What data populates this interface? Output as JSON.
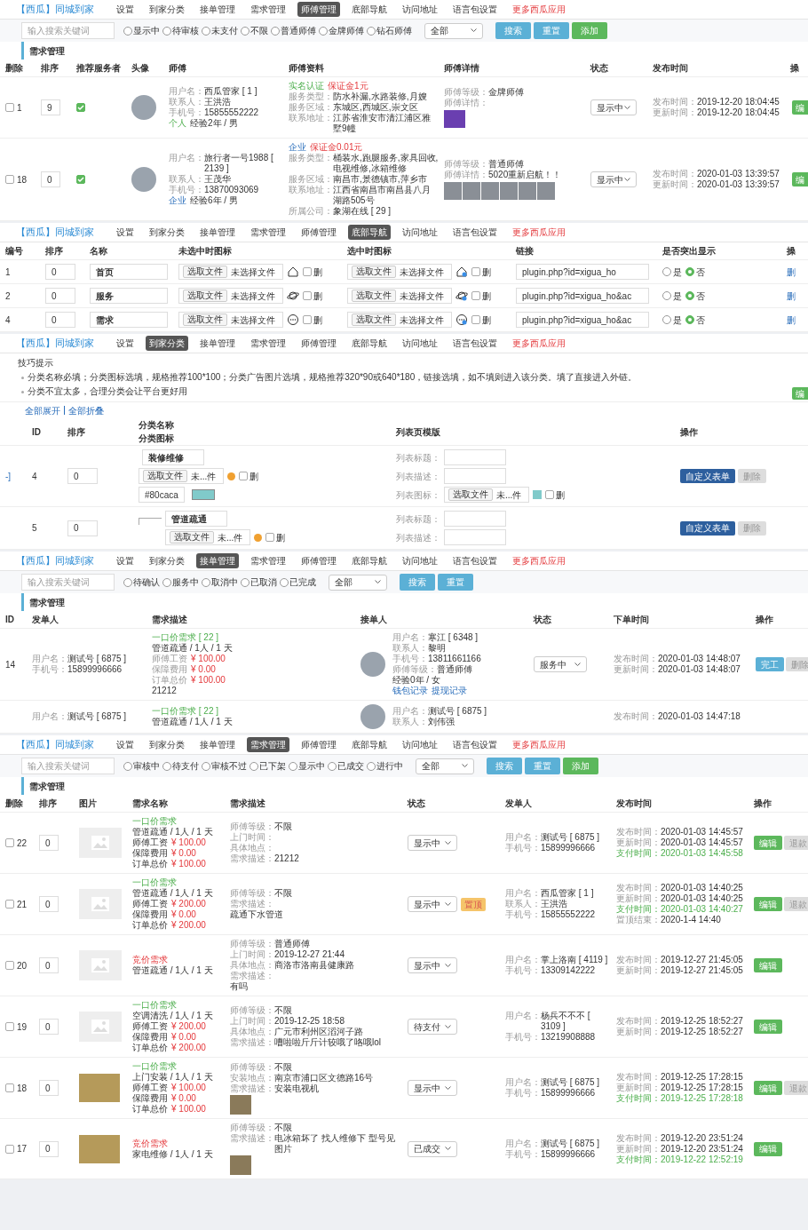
{
  "sections": [
    {
      "kind": "masters",
      "nav": {
        "brand": "【西瓜】同城到家",
        "items": [
          {
            "label": "设置",
            "selected": false
          },
          {
            "label": "到家分类",
            "selected": false
          },
          {
            "label": "接单管理",
            "selected": false
          },
          {
            "label": "需求管理",
            "selected": false
          },
          {
            "label": "师傅管理",
            "selected": true
          },
          {
            "label": "底部导航",
            "selected": false
          },
          {
            "label": "访问地址",
            "selected": false
          },
          {
            "label": "语言包设置",
            "selected": false
          },
          {
            "label": "更多西瓜应用",
            "selected": false,
            "kind": "promo"
          }
        ]
      },
      "toolbar": {
        "placeholder": "输入搜索关键词",
        "radios": [
          {
            "label": "显示中",
            "selected": false
          },
          {
            "label": "待审核",
            "selected": false
          },
          {
            "label": "未支付",
            "selected": false
          },
          {
            "label": "不限",
            "selected": false
          },
          {
            "label": "普通师傅",
            "selected": false
          },
          {
            "label": "金牌师傅",
            "selected": false
          },
          {
            "label": "钻石师傅",
            "selected": false
          }
        ],
        "select": "全部",
        "buttons": [
          {
            "label": "搜索",
            "kind": "search"
          },
          {
            "label": "重置",
            "kind": "reset"
          },
          {
            "label": "添加",
            "kind": "add"
          }
        ]
      },
      "title": "需求管理",
      "columns": [
        "删除",
        "排序",
        "推荐服务者",
        "头像",
        "师傅",
        "师傅资料",
        "师傅详情",
        "状态",
        "发布时间",
        "操"
      ],
      "rows": [
        {
          "id": "1",
          "checked": false,
          "sort": "9",
          "recommended": true,
          "master": [
            {
              "kind": "field",
              "label": "用户名：",
              "value": "西瓜管家 [ 1 ]"
            },
            {
              "kind": "field",
              "label": "联系人：",
              "value": "王洪浩"
            },
            {
              "kind": "field",
              "label": "手机号：",
              "value": "15855552222"
            },
            {
              "kind": "personal",
              "label": "个人",
              "value": "经验2年 / 男"
            }
          ],
          "profile": [
            {
              "kind": "verified",
              "label": "实名认证",
              "value": "保证金1元"
            },
            {
              "kind": "field",
              "label": "服务类型：",
              "value": "防水补漏,水路装修,月嫂"
            },
            {
              "kind": "field",
              "label": "服务区域：",
              "value": "东城区,西城区,崇文区"
            },
            {
              "kind": "field",
              "label": "联系地址：",
              "value": "江苏省淮安市清江浦区雅墅9幢"
            }
          ],
          "detail": [
            {
              "kind": "field",
              "label": "师傅等级：",
              "value": "金牌师傅"
            },
            {
              "kind": "field",
              "label": "师傅详情："
            }
          ],
          "photo_strip": false,
          "status": "显示中",
          "times": [
            {
              "kind": "field",
              "label": "发布时间：",
              "value": "2019-12-20 18:04:45"
            },
            {
              "kind": "field",
              "label": "更新时间：",
              "value": "2019-12-20 18:04:45"
            }
          ],
          "action": "编"
        },
        {
          "id": "18",
          "checked": false,
          "sort": "0",
          "recommended": true,
          "master": [
            {
              "kind": "field",
              "label": "用户名：",
              "value": "旅行者一号1988 [ 2139 ]"
            },
            {
              "kind": "field",
              "label": "联系人：",
              "value": "王茂华"
            },
            {
              "kind": "field",
              "label": "手机号：",
              "value": "13870093069"
            },
            {
              "kind": "company",
              "label": "企业",
              "value": "经验6年 / 男"
            }
          ],
          "profile": [
            {
              "kind": "company_deposit",
              "label": "企业",
              "value": "保证金0.01元"
            },
            {
              "kind": "field",
              "label": "服务类型：",
              "value": "桶装水,跑腿服务,家具回收,电视维修,冰箱维修"
            },
            {
              "kind": "field",
              "label": "服务区域：",
              "value": "南昌市,景德镇市,萍乡市"
            },
            {
              "kind": "field",
              "label": "联系地址：",
              "value": "江西省南昌市南昌县八月湖路505号"
            },
            {
              "kind": "field",
              "label": "所属公司：",
              "value": "象湖在线 [ 29 ]"
            }
          ],
          "detail": [
            {
              "kind": "field",
              "label": "师傅等级：",
              "value": "普通师傅"
            },
            {
              "kind": "field",
              "label": "师傅详情：",
              "value": "5020重新启航！！"
            }
          ],
          "photo_strip": true,
          "status": "显示中",
          "times": [
            {
              "kind": "field",
              "label": "发布时间：",
              "value": "2020-01-03 13:39:57"
            },
            {
              "kind": "field",
              "label": "更新时间：",
              "value": "2020-01-03 13:39:57"
            }
          ],
          "action": "编"
        }
      ]
    },
    {
      "kind": "tabbar",
      "nav": {
        "brand": "【西瓜】同城到家",
        "items": [
          {
            "label": "设置",
            "selected": false
          },
          {
            "label": "到家分类",
            "selected": false
          },
          {
            "label": "接单管理",
            "selected": false
          },
          {
            "label": "需求管理",
            "selected": false
          },
          {
            "label": "师傅管理",
            "selected": false
          },
          {
            "label": "底部导航",
            "selected": true
          },
          {
            "label": "访问地址",
            "selected": false
          },
          {
            "label": "语言包设置",
            "selected": false
          },
          {
            "label": "更多西瓜应用",
            "selected": false,
            "kind": "promo"
          }
        ]
      },
      "columns": [
        "编号",
        "排序",
        "名称",
        "未选中时图标",
        "选中时图标",
        "链接",
        "是否突出显示",
        "操"
      ],
      "rows": [
        {
          "id": "1",
          "sort": "0",
          "name": "首页",
          "file_button": "选取文件",
          "file_status": "未选择文件",
          "selected_file_button": "选取文件",
          "selected_file_status": "未选择文件",
          "delete_label": "删",
          "delete_checked": false,
          "selected_delete_label": "删",
          "selected_delete_checked": false,
          "link": "plugin.php?id=xigua_ho",
          "options": [
            {
              "label": "是",
              "selected": false
            },
            {
              "label": "否",
              "selected": true
            }
          ],
          "action": "删"
        },
        {
          "id": "2",
          "sort": "0",
          "name": "服务",
          "file_button": "选取文件",
          "file_status": "未选择文件",
          "selected_file_button": "选取文件",
          "selected_file_status": "未选择文件",
          "delete_label": "删",
          "delete_checked": false,
          "selected_delete_label": "删",
          "selected_delete_checked": false,
          "link": "plugin.php?id=xigua_ho&ac",
          "options": [
            {
              "label": "是",
              "selected": false
            },
            {
              "label": "否",
              "selected": true
            }
          ],
          "action": "删"
        },
        {
          "id": "4",
          "sort": "0",
          "name": "需求",
          "file_button": "选取文件",
          "file_status": "未选择文件",
          "selected_file_button": "选取文件",
          "selected_file_status": "未选择文件",
          "delete_label": "删",
          "delete_checked": false,
          "selected_delete_label": "删",
          "selected_delete_checked": false,
          "link": "plugin.php?id=xigua_ho&ac",
          "options": [
            {
              "label": "是",
              "selected": false
            },
            {
              "label": "否",
              "selected": true
            }
          ],
          "action": "删"
        }
      ]
    },
    {
      "kind": "category",
      "nav": {
        "brand": "【西瓜】同城到家",
        "items": [
          {
            "label": "设置",
            "selected": false
          },
          {
            "label": "到家分类",
            "selected": true
          },
          {
            "label": "接单管理",
            "selected": false
          },
          {
            "label": "需求管理",
            "selected": false
          },
          {
            "label": "师傅管理",
            "selected": false
          },
          {
            "label": "底部导航",
            "selected": false
          },
          {
            "label": "访问地址",
            "selected": false
          },
          {
            "label": "语言包设置",
            "selected": false
          },
          {
            "label": "更多西瓜应用",
            "selected": false,
            "kind": "promo"
          }
        ]
      },
      "tips_title": "技巧提示",
      "tips": [
        "分类名称必填；分类图标选填，规格推荐100*100；分类广告图片选填，规格推荐320*90或640*180，链接选填，如不填则进入该分类。填了直接进入外链。",
        "分类不宜太多，合理分类会让平台更好用"
      ],
      "side_button": "编",
      "expand_all": "全部展开",
      "collapse_all": "全部折叠",
      "columns": [
        "ID",
        "排序",
        "分类名称",
        "列表页模版",
        "操作"
      ],
      "name_column_subtitle": "分类图标",
      "rows": [
        {
          "toggle": "-]",
          "id": "4",
          "sort": "0",
          "child": false,
          "name": "装修维修",
          "file_button": "选取文件",
          "file_status": "未...件",
          "delete_label": "删",
          "delete_checked": false,
          "color_value": "#80caca",
          "fields": [
            {
              "kind": "text",
              "label": "列表标题："
            },
            {
              "kind": "text",
              "label": "列表描述："
            },
            {
              "kind": "file",
              "label": "列表图标：",
              "file_button": "选取文件",
              "file_status": "未...件",
              "delete_label": "删",
              "delete_checked": false
            }
          ],
          "buttons": [
            {
              "label": "自定义表单",
              "kind": "form"
            },
            {
              "label": "删除",
              "kind": "disabled"
            }
          ]
        },
        {
          "id": "5",
          "sort": "0",
          "child": true,
          "name": "管道疏通",
          "file_button": "选取文件",
          "file_status": "未...件",
          "delete_label": "删",
          "delete_checked": false,
          "fields": [
            {
              "kind": "text",
              "label": "列表标题："
            },
            {
              "kind": "text",
              "label": "列表描述："
            }
          ],
          "buttons": [
            {
              "label": "自定义表单",
              "kind": "form"
            },
            {
              "label": "删除",
              "kind": "disabled"
            }
          ]
        }
      ]
    },
    {
      "kind": "orders",
      "nav": {
        "brand": "【西瓜】同城到家",
        "items": [
          {
            "label": "设置",
            "selected": false
          },
          {
            "label": "到家分类",
            "selected": false
          },
          {
            "label": "接单管理",
            "selected": true
          },
          {
            "label": "需求管理",
            "selected": false
          },
          {
            "label": "师傅管理",
            "selected": false
          },
          {
            "label": "底部导航",
            "selected": false
          },
          {
            "label": "访问地址",
            "selected": false
          },
          {
            "label": "语言包设置",
            "selected": false
          },
          {
            "label": "更多西瓜应用",
            "selected": false,
            "kind": "promo"
          }
        ]
      },
      "toolbar": {
        "placeholder": "输入搜索关键词",
        "radios": [
          {
            "label": "待确认",
            "selected": false
          },
          {
            "label": "服务中",
            "selected": false
          },
          {
            "label": "取消中",
            "selected": false
          },
          {
            "label": "已取消",
            "selected": false
          },
          {
            "label": "已完成",
            "selected": false
          }
        ],
        "select": "全部",
        "buttons": [
          {
            "label": "搜索",
            "kind": "search"
          },
          {
            "label": "重置",
            "kind": "reset"
          }
        ]
      },
      "title": "需求管理",
      "columns": [
        "ID",
        "发单人",
        "需求描述",
        "接单人",
        "状态",
        "下单时间",
        "操作"
      ],
      "rows": [
        {
          "id": "14",
          "sender": [
            {
              "kind": "field",
              "label": "用户名：",
              "value": "测试号 [ 6875 ]"
            },
            {
              "kind": "field",
              "label": "手机号：",
              "value": "15899996666"
            }
          ],
          "desc": [
            {
              "kind": "fixed_price",
              "value": "一口价需求 [ 22 ]"
            },
            {
              "kind": "field",
              "value": "管道疏通 / 1人 / 1 天"
            },
            {
              "kind": "fee",
              "label": "师傅工资",
              "value": "¥ 100.00"
            },
            {
              "kind": "fee",
              "label": "保障费用",
              "value": "¥ 0.00"
            },
            {
              "kind": "fee",
              "label": "订单总价",
              "value": "¥ 100.00"
            },
            {
              "kind": "field",
              "value": "21212"
            }
          ],
          "taker": [
            {
              "kind": "field",
              "label": "用户名：",
              "value": "寒江 [ 6348 ]"
            },
            {
              "kind": "field",
              "label": "联系人：",
              "value": "黎明"
            },
            {
              "kind": "field",
              "label": "手机号：",
              "value": "13811661166"
            },
            {
              "kind": "field",
              "label": "师傅等级：",
              "value": "普通师傅"
            },
            {
              "kind": "field",
              "value": "经验0年 / 女"
            }
          ],
          "links": [
            "钱包记录",
            "提现记录"
          ],
          "status": "服务中",
          "times": [
            {
              "kind": "field",
              "label": "发布时间：",
              "value": "2020-01-03 14:48:07"
            },
            {
              "kind": "field",
              "label": "更新时间：",
              "value": "2020-01-03 14:48:07"
            }
          ],
          "buttons": [
            {
              "label": "完工",
              "kind": "complete"
            },
            {
              "label": "删除",
              "kind": "disabled"
            }
          ]
        },
        {
          "sender": [
            {
              "kind": "field",
              "label": "用户名：",
              "value": "测试号 [ 6875 ]"
            }
          ],
          "desc": [
            {
              "kind": "fixed_price",
              "value": "一口价需求 [ 22 ]"
            },
            {
              "kind": "field",
              "value": "管道疏通 / 1人 / 1 天"
            }
          ],
          "taker": [
            {
              "kind": "field",
              "label": "用户名：",
              "value": "测试号 [ 6875 ]"
            },
            {
              "kind": "field",
              "label": "联系人：",
              "value": "刘伟强"
            }
          ],
          "times": [
            {
              "kind": "field",
              "label": "发布时间：",
              "value": "2020-01-03 14:47:18"
            }
          ]
        }
      ]
    },
    {
      "kind": "demands",
      "nav": {
        "brand": "【西瓜】同城到家",
        "items": [
          {
            "label": "设置",
            "selected": false
          },
          {
            "label": "到家分类",
            "selected": false
          },
          {
            "label": "接单管理",
            "selected": false
          },
          {
            "label": "需求管理",
            "selected": true
          },
          {
            "label": "师傅管理",
            "selected": false
          },
          {
            "label": "底部导航",
            "selected": false
          },
          {
            "label": "访问地址",
            "selected": false
          },
          {
            "label": "语言包设置",
            "selected": false
          },
          {
            "label": "更多西瓜应用",
            "selected": false,
            "kind": "promo"
          }
        ]
      },
      "toolbar": {
        "placeholder": "输入搜索关键词",
        "radios": [
          {
            "label": "审核中",
            "selected": false
          },
          {
            "label": "待支付",
            "selected": false
          },
          {
            "label": "审核不过",
            "selected": false
          },
          {
            "label": "已下架",
            "selected": false
          },
          {
            "label": "显示中",
            "selected": false
          },
          {
            "label": "已成交",
            "selected": false
          },
          {
            "label": "进行中",
            "selected": false
          }
        ],
        "select": "全部",
        "buttons": [
          {
            "label": "搜索",
            "kind": "search"
          },
          {
            "label": "重置",
            "kind": "reset"
          },
          {
            "label": "添加",
            "kind": "add"
          }
        ]
      },
      "title": "需求管理",
      "columns": [
        "删除",
        "排序",
        "图片",
        "需求名称",
        "需求描述",
        "状态",
        "发单人",
        "发布时间",
        "操作"
      ],
      "rows": [
        {
          "id": "22",
          "checked": false,
          "sort": "0",
          "photo": false,
          "name": [
            {
              "kind": "fixed_price",
              "value": "一口价需求"
            },
            {
              "kind": "field",
              "value": "管道疏通 / 1人 / 1 天"
            },
            {
              "kind": "cost",
              "label": "师傅工资",
              "value": "¥ 100.00"
            },
            {
              "kind": "cost",
              "label": "保障费用",
              "value": "¥ 0.00"
            },
            {
              "kind": "cost",
              "label": "订单总价",
              "value": "¥ 100.00"
            }
          ],
          "desc": [
            {
              "kind": "field",
              "label": "师傅等级：",
              "value": "不限"
            },
            {
              "kind": "field",
              "label": "上门时间："
            },
            {
              "kind": "field",
              "label": "具体地点："
            },
            {
              "kind": "field",
              "label": "需求描述：",
              "value": "21212"
            }
          ],
          "desc_photo": false,
          "status": "显示中",
          "sender": [
            {
              "kind": "field",
              "label": "用户名：",
              "value": "测试号 [ 6875 ]"
            },
            {
              "kind": "field",
              "label": "手机号：",
              "value": "15899996666"
            }
          ],
          "times": [
            {
              "kind": "field",
              "label": "发布时间：",
              "value": "2020-01-03 14:45:57"
            },
            {
              "kind": "field",
              "label": "更新时间：",
              "value": "2020-01-03 14:45:57"
            },
            {
              "kind": "paid",
              "label": "支付时间：",
              "value": "2020-01-03 14:45:58"
            }
          ],
          "buttons": [
            {
              "label": "编辑",
              "kind": "edit"
            },
            {
              "label": "退款",
              "kind": "disabled"
            }
          ]
        },
        {
          "id": "21",
          "checked": false,
          "sort": "0",
          "photo": false,
          "name": [
            {
              "kind": "fixed_price",
              "value": "一口价需求"
            },
            {
              "kind": "field",
              "value": "管道疏通 / 1人 / 1 天"
            },
            {
              "kind": "cost",
              "label": "师傅工资",
              "value": "¥ 200.00"
            },
            {
              "kind": "cost",
              "label": "保障费用",
              "value": "¥ 0.00"
            },
            {
              "kind": "cost",
              "label": "订单总价",
              "value": "¥ 200.00"
            }
          ],
          "desc": [
            {
              "kind": "field",
              "label": "师傅等级：",
              "value": "不限"
            },
            {
              "kind": "field",
              "label": "需求描述："
            },
            {
              "kind": "field",
              "value": "疏通下水管道"
            }
          ],
          "desc_photo": false,
          "status": "显示中",
          "badge": "置顶",
          "sender": [
            {
              "kind": "field",
              "label": "用户名：",
              "value": "西瓜管家 [ 1 ]"
            },
            {
              "kind": "field",
              "label": "联系人：",
              "value": "王洪浩"
            },
            {
              "kind": "field",
              "label": "手机号：",
              "value": "15855552222"
            }
          ],
          "times": [
            {
              "kind": "field",
              "label": "发布时间：",
              "value": "2020-01-03 14:40:25"
            },
            {
              "kind": "field",
              "label": "更新时间：",
              "value": "2020-01-03 14:40:25"
            },
            {
              "kind": "paid",
              "label": "支付时间：",
              "value": "2020-01-03 14:40:27"
            },
            {
              "kind": "field",
              "label": "置顶结束：",
              "value": "2020-1-4 14:40"
            }
          ],
          "buttons": [
            {
              "label": "编辑",
              "kind": "edit"
            },
            {
              "label": "退款",
              "kind": "disabled"
            }
          ]
        },
        {
          "id": "20",
          "checked": false,
          "sort": "0",
          "photo": false,
          "name": [
            {
              "kind": "bidding",
              "value": "竞价需求"
            },
            {
              "kind": "field",
              "value": "管道疏通 / 1人 / 1 天"
            }
          ],
          "desc": [
            {
              "kind": "field",
              "label": "师傅等级：",
              "value": "普通师傅"
            },
            {
              "kind": "field",
              "label": "上门时间：",
              "value": "2019-12-27 21:44"
            },
            {
              "kind": "field",
              "label": "具体地点：",
              "value": "商洛市洛南县健康路"
            },
            {
              "kind": "field",
              "label": "需求描述："
            },
            {
              "kind": "field",
              "value": "有吗"
            }
          ],
          "desc_photo": false,
          "status": "显示中",
          "sender": [
            {
              "kind": "field",
              "label": "用户名：",
              "value": "掌上洛南 [ 4119 ]"
            },
            {
              "kind": "field",
              "label": "手机号：",
              "value": "13309142222"
            }
          ],
          "times": [
            {
              "kind": "field",
              "label": "发布时间：",
              "value": "2019-12-27 21:45:05"
            },
            {
              "kind": "field",
              "label": "更新时间：",
              "value": "2019-12-27 21:45:05"
            }
          ],
          "buttons": [
            {
              "label": "编辑",
              "kind": "edit"
            }
          ]
        },
        {
          "id": "19",
          "checked": false,
          "sort": "0",
          "photo": false,
          "name": [
            {
              "kind": "fixed_price",
              "value": "一口价需求"
            },
            {
              "kind": "field",
              "value": "空调清洗 / 1人 / 1 天"
            },
            {
              "kind": "cost",
              "label": "师傅工资",
              "value": "¥ 200.00"
            },
            {
              "kind": "cost",
              "label": "保障费用",
              "value": "¥ 0.00"
            },
            {
              "kind": "cost",
              "label": "订单总价",
              "value": "¥ 200.00"
            }
          ],
          "desc": [
            {
              "kind": "field",
              "label": "师傅等级：",
              "value": "不限"
            },
            {
              "kind": "field",
              "label": "上门时间：",
              "value": "2019-12-25 18:58"
            },
            {
              "kind": "field",
              "label": "具体地点：",
              "value": "广元市利州区滔河子路"
            },
            {
              "kind": "field",
              "label": "需求描述：",
              "value": "嘈啦啦斤斤计较哦了咯哦lol"
            }
          ],
          "desc_photo": false,
          "status": "待支付",
          "sender": [
            {
              "kind": "field",
              "label": "用户名：",
              "value": "杨兵不不不 [ 3109 ]"
            },
            {
              "kind": "field",
              "label": "手机号：",
              "value": "13219908888"
            }
          ],
          "times": [
            {
              "kind": "field",
              "label": "发布时间：",
              "value": "2019-12-25 18:52:27"
            },
            {
              "kind": "field",
              "label": "更新时间：",
              "value": "2019-12-25 18:52:27"
            }
          ],
          "buttons": [
            {
              "label": "编辑",
              "kind": "edit"
            }
          ]
        },
        {
          "id": "18",
          "checked": false,
          "sort": "0",
          "photo": true,
          "name": [
            {
              "kind": "fixed_price",
              "value": "一口价需求"
            },
            {
              "kind": "field",
              "value": "上门安装 / 1人 / 1 天"
            },
            {
              "kind": "cost",
              "label": "师傅工资",
              "value": "¥ 100.00"
            },
            {
              "kind": "cost",
              "label": "保障费用",
              "value": "¥ 0.00"
            },
            {
              "kind": "cost",
              "label": "订单总价",
              "value": "¥ 100.00"
            }
          ],
          "desc": [
            {
              "kind": "field",
              "label": "师傅等级：",
              "value": "不限"
            },
            {
              "kind": "field",
              "label": "安装地点：",
              "value": "南京市浦口区文德路16号"
            },
            {
              "kind": "field",
              "label": "需求描述：",
              "value": "安装电视机"
            }
          ],
          "desc_photo": true,
          "status": "显示中",
          "sender": [
            {
              "kind": "field",
              "label": "用户名：",
              "value": "测试号 [ 6875 ]"
            },
            {
              "kind": "field",
              "label": "手机号：",
              "value": "15899996666"
            }
          ],
          "times": [
            {
              "kind": "field",
              "label": "发布时间：",
              "value": "2019-12-25 17:28:15"
            },
            {
              "kind": "field",
              "label": "更新时间：",
              "value": "2019-12-25 17:28:15"
            },
            {
              "kind": "paid",
              "label": "支付时间：",
              "value": "2019-12-25 17:28:18"
            }
          ],
          "buttons": [
            {
              "label": "编辑",
              "kind": "edit"
            },
            {
              "label": "退款",
              "kind": "disabled"
            }
          ]
        },
        {
          "id": "17",
          "checked": false,
          "sort": "0",
          "photo": true,
          "name": [
            {
              "kind": "bidding",
              "value": "竞价需求"
            },
            {
              "kind": "field",
              "value": "家电维修 / 1人 / 1 天"
            }
          ],
          "desc": [
            {
              "kind": "field",
              "label": "师傅等级：",
              "value": "不限"
            },
            {
              "kind": "field",
              "label": "需求描述：",
              "value": "电冰箱坏了 找人维修下 型号见图片"
            }
          ],
          "desc_photo": true,
          "status": "已成交",
          "sender": [
            {
              "kind": "field",
              "label": "用户名：",
              "value": "测试号 [ 6875 ]"
            },
            {
              "kind": "field",
              "label": "手机号：",
              "value": "15899996666"
            }
          ],
          "times": [
            {
              "kind": "field",
              "label": "发布时间：",
              "value": "2019-12-20 23:51:24"
            },
            {
              "kind": "field",
              "label": "更新时间：",
              "value": "2019-12-20 23:51:24"
            },
            {
              "kind": "paid",
              "label": "支付时间：",
              "value": "2019-12-22 12:52:19"
            }
          ],
          "buttons": [
            {
              "label": "编辑",
              "kind": "edit"
            }
          ]
        }
      ]
    }
  ]
}
